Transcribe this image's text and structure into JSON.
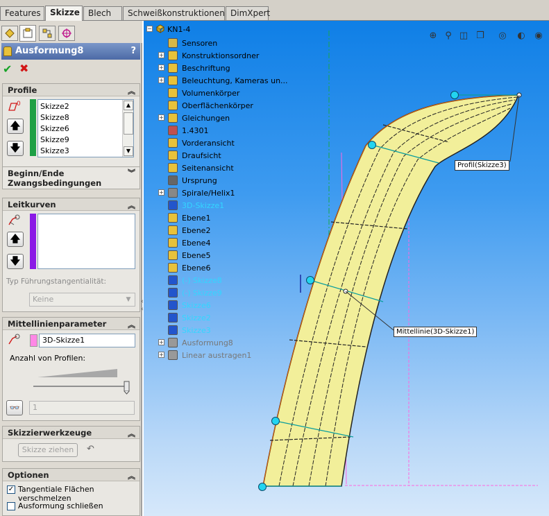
{
  "tabs": [
    "Features",
    "Skizze",
    "Blech",
    "Schweißkonstruktionen",
    "DimXpert"
  ],
  "active_tab": "Skizze",
  "feature": {
    "title": "Ausformung8",
    "help": "?"
  },
  "profile": {
    "title": "Profile",
    "items": [
      "Skizze2",
      "Skizze8",
      "Skizze6",
      "Skizze9",
      "Skizze3"
    ],
    "bar_color": "#1ea046"
  },
  "beginn_ende": {
    "title_line1": "Beginn/Ende",
    "title_line2": "Zwangsbedingungen"
  },
  "leitkurven": {
    "title": "Leitkurven",
    "bar_color": "#8a1ae6",
    "tangency_label": "Typ Führungstangentialität:",
    "tangency_value": "Keine"
  },
  "mittellinie": {
    "title": "Mittellinienparameter",
    "value": "3D-Skizze1",
    "swatch_color": "#ff88e6",
    "profiles_label": "Anzahl von Profilen:",
    "profiles_count": "1"
  },
  "skizzierwerkzeuge": {
    "title": "Skizzierwerkzeuge",
    "button_label": "Skizze ziehen"
  },
  "optionen": {
    "title": "Optionen",
    "tangent_label": "Tangentiale Flächen verschmelzen",
    "tangent_checked": true,
    "close_label": "Ausformung schließen",
    "close_checked": false
  },
  "tree": {
    "root": "KN1-4",
    "items": [
      {
        "label": "Sensoren",
        "style": "normal"
      },
      {
        "label": "Konstruktionsordner",
        "style": "normal"
      },
      {
        "label": "Beschriftung",
        "style": "normal"
      },
      {
        "label": "Beleuchtung, Kameras un...",
        "style": "normal"
      },
      {
        "label": "Volumenkörper",
        "style": "normal"
      },
      {
        "label": "Oberflächenkörper",
        "style": "normal"
      },
      {
        "label": "Gleichungen",
        "style": "normal"
      },
      {
        "label": "1.4301",
        "style": "normal"
      },
      {
        "label": "Vorderansicht",
        "style": "normal"
      },
      {
        "label": "Draufsicht",
        "style": "normal"
      },
      {
        "label": "Seitenansicht",
        "style": "normal"
      },
      {
        "label": "Ursprung",
        "style": "normal"
      },
      {
        "label": "Spirale/Helix1",
        "style": "normal"
      },
      {
        "label": "3D-Skizze1",
        "style": "blue"
      },
      {
        "label": "Ebene1",
        "style": "normal"
      },
      {
        "label": "Ebene2",
        "style": "normal"
      },
      {
        "label": "Ebene4",
        "style": "normal"
      },
      {
        "label": "Ebene5",
        "style": "normal"
      },
      {
        "label": "Ebene6",
        "style": "normal"
      },
      {
        "label": "(-) Skizze8",
        "style": "blue"
      },
      {
        "label": "(-) Skizze9",
        "style": "blue"
      },
      {
        "label": "Skizze6",
        "style": "blue"
      },
      {
        "label": "Skizze2",
        "style": "blue"
      },
      {
        "label": "Skizze3",
        "style": "blue"
      },
      {
        "label": "Ausformung8",
        "style": "gray"
      },
      {
        "label": "Linear austragen1",
        "style": "gray"
      }
    ]
  },
  "callouts": {
    "profil": "Profil(Skizze3)",
    "mittellinie": "Mittellinie(3D-Skizze1)"
  },
  "colors": {
    "surface": "#f2ef9a",
    "viewport_top": "#0f7fe6",
    "viewport_bottom": "#d6e8fa",
    "header_blue": "#4c6aa6"
  }
}
